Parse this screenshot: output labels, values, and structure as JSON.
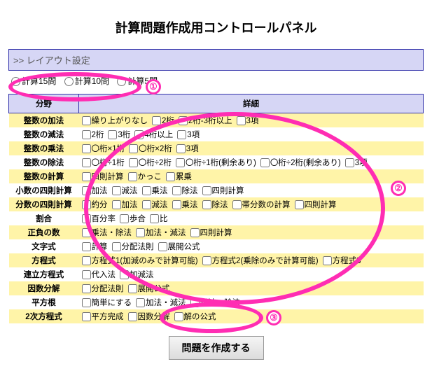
{
  "title": "計算問題作成用コントロールパネル",
  "layoutLabel": ">> レイアウト設定",
  "radios": {
    "r1": "計算15問",
    "r2": "計算10問",
    "r3": "計算5問"
  },
  "headers": {
    "field": "分野",
    "detail": "詳細"
  },
  "rows": [
    {
      "field": "整数の加法",
      "opts": [
        "繰り上がりなし",
        "2桁",
        "2桁-3桁以上",
        "3項"
      ]
    },
    {
      "field": "整数の減法",
      "opts": [
        "2桁",
        "3桁",
        "4桁以上",
        "3項"
      ]
    },
    {
      "field": "整数の乗法",
      "opts": [
        "〇桁×1桁",
        "〇桁×2桁",
        "3項"
      ]
    },
    {
      "field": "整数の除法",
      "opts": [
        "〇桁÷1桁",
        "〇桁÷2桁",
        "〇桁÷1桁(剰余あり)",
        "〇桁÷2桁(剰余あり)",
        "3項"
      ]
    },
    {
      "field": "整数の計算",
      "opts": [
        "四則計算",
        "かっこ",
        "累乗"
      ]
    },
    {
      "field": "小数の四則計算",
      "opts": [
        "加法",
        "減法",
        "乗法",
        "除法",
        "四則計算"
      ]
    },
    {
      "field": "分数の四則計算",
      "opts": [
        "約分",
        "加法",
        "減法",
        "乗法",
        "除法",
        "帯分数の計算",
        "四則計算"
      ]
    },
    {
      "field": "割合",
      "opts": [
        "百分率",
        "歩合",
        "比"
      ]
    },
    {
      "field": "正負の数",
      "opts": [
        "乗法・除法",
        "加法・減法",
        "四則計算"
      ]
    },
    {
      "field": "文字式",
      "opts": [
        "計算",
        "分配法則",
        "展開公式"
      ]
    },
    {
      "field": "方程式",
      "opts": [
        "方程式1(加減のみで計算可能)",
        "方程式2(乗除のみで計算可能)",
        "方程式3"
      ]
    },
    {
      "field": "連立方程式",
      "opts": [
        "代入法",
        "加減法"
      ]
    },
    {
      "field": "因数分解",
      "opts": [
        "分配法則",
        "展開公式"
      ]
    },
    {
      "field": "平方根",
      "opts": [
        "簡単にする",
        "加法・減法",
        "乗法・除法"
      ]
    },
    {
      "field": "2次方程式",
      "opts": [
        "平方完成",
        "因数分解",
        "解の公式"
      ]
    }
  ],
  "button": "問題を作成する",
  "annotations": {
    "n1": "①",
    "n2": "②",
    "n3": "③"
  }
}
